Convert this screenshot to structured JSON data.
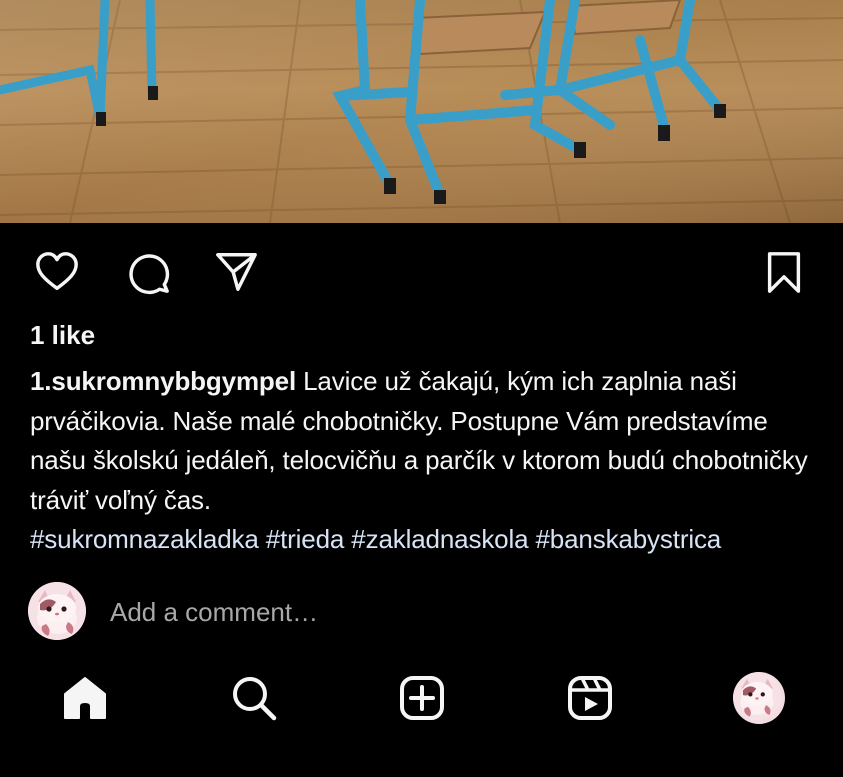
{
  "post": {
    "likes": "1 like",
    "username": "1.sukromnybbgympel",
    "caption_text": " Lavice už čakajú, kým ich zaplnia naši prváčikovia. Naše malé chobotničky. Postupne Vám predstavíme našu školskú jedáleň, telocvičňu a parčík v ktorom budú chobotničky tráviť voľný čas.",
    "hashtags": "#sukromnazakladka #trieda #zakladnaskola #banskabystrica"
  },
  "comment": {
    "placeholder": "Add a comment…"
  },
  "icons": {
    "like": "heart-icon",
    "comment": "comment-bubble-icon",
    "share": "paper-plane-icon",
    "save": "bookmark-icon",
    "home": "home-icon",
    "search": "search-icon",
    "create": "plus-square-icon",
    "reels": "reels-icon"
  },
  "colors": {
    "background": "#000000",
    "text": "#f5f5f5",
    "hashtag": "#d8e4f6",
    "placeholder": "#a8a8a8",
    "chair_frame": "#3a9fc8",
    "floor": "#b3875a"
  }
}
